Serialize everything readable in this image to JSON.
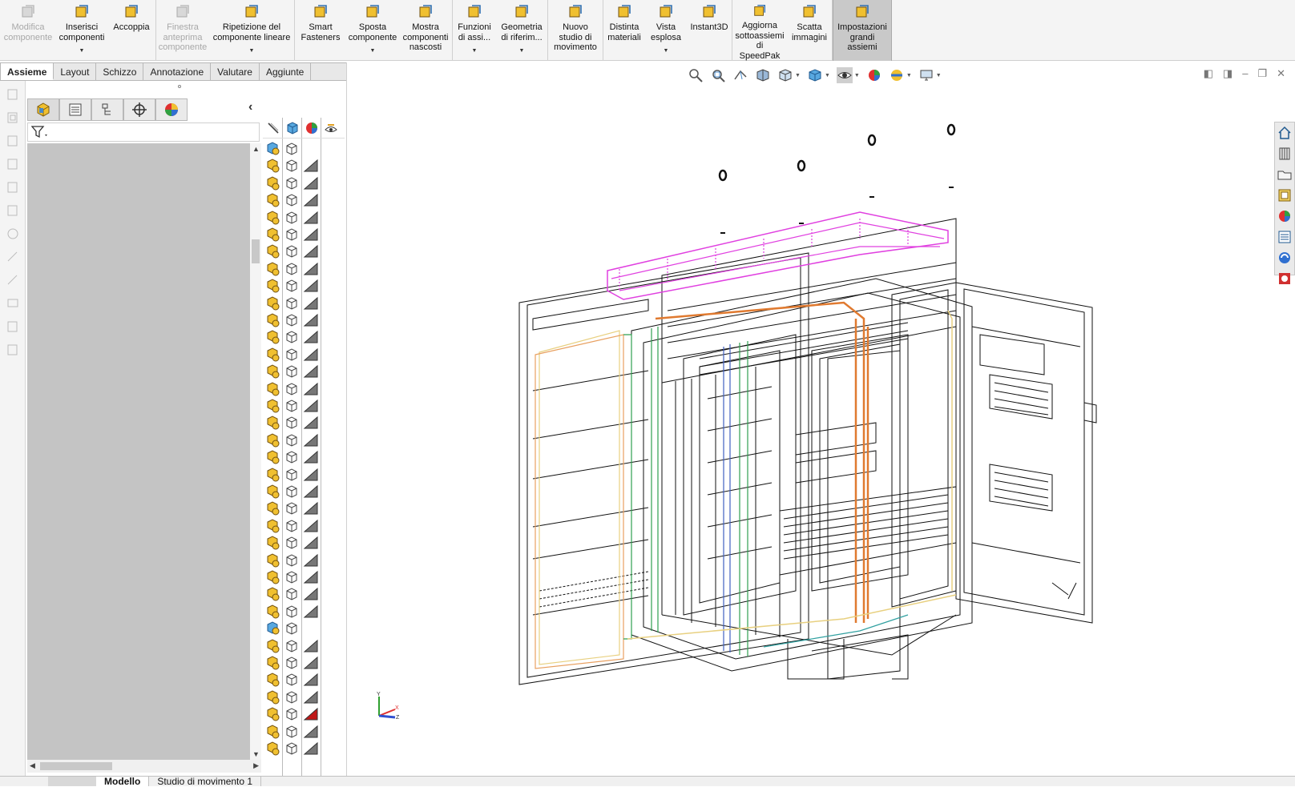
{
  "ribbon": {
    "buttons": [
      {
        "label": "Modifica componente",
        "icon": "edit-component-icon",
        "disabled": true
      },
      {
        "label": "Inserisci componenti",
        "icon": "insert-components-icon",
        "dropdown": true
      },
      {
        "label": "Accoppia",
        "icon": "mate-icon"
      },
      {
        "label": "Finestra anteprima componente",
        "icon": "preview-window-icon",
        "disabled": true
      },
      {
        "label": "Ripetizione del componente lineare",
        "icon": "linear-pattern-icon",
        "dropdown": true
      },
      {
        "label": "Smart Fasteners",
        "icon": "smart-fasteners-icon"
      },
      {
        "label": "Sposta componente",
        "icon": "move-component-icon",
        "dropdown": true
      },
      {
        "label": "Mostra componenti nascosti",
        "icon": "show-hidden-icon"
      },
      {
        "label": "Funzioni di assi...",
        "icon": "assembly-features-icon",
        "dropdown": true
      },
      {
        "label": "Geometria di riferim...",
        "icon": "reference-geometry-icon",
        "dropdown": true
      },
      {
        "label": "Nuovo studio di movimento",
        "icon": "motion-study-icon"
      },
      {
        "label": "Distinta materiali",
        "icon": "bill-of-materials-icon"
      },
      {
        "label": "Vista esplosa",
        "icon": "exploded-view-icon",
        "dropdown": true
      },
      {
        "label": "Instant3D",
        "icon": "instant3d-icon"
      },
      {
        "label": "Aggiorna sottoassiemi di SpeedPak",
        "icon": "speedpak-icon"
      },
      {
        "label": "Scatta immagini",
        "icon": "camera-icon"
      },
      {
        "label": "Impostazioni grandi assiemi",
        "icon": "large-assembly-icon",
        "active": true
      }
    ]
  },
  "command_tabs": [
    "Assieme",
    "Layout",
    "Schizzo",
    "Annotazione",
    "Valutare",
    "Aggiunte"
  ],
  "bottom_tabs": [
    "Modello",
    "Studio di movimento 1"
  ],
  "colors": {
    "ribbon_bg": "#f4f4f4",
    "tree_bg": "#c4c4c4",
    "active_tab": "#c9c9c9",
    "highlight_magenta": "#e040e0",
    "wire_orange": "#e07a30",
    "wire_yellow": "#e8d080",
    "wire_green": "#30a050",
    "wire_blue": "#4060c0"
  }
}
